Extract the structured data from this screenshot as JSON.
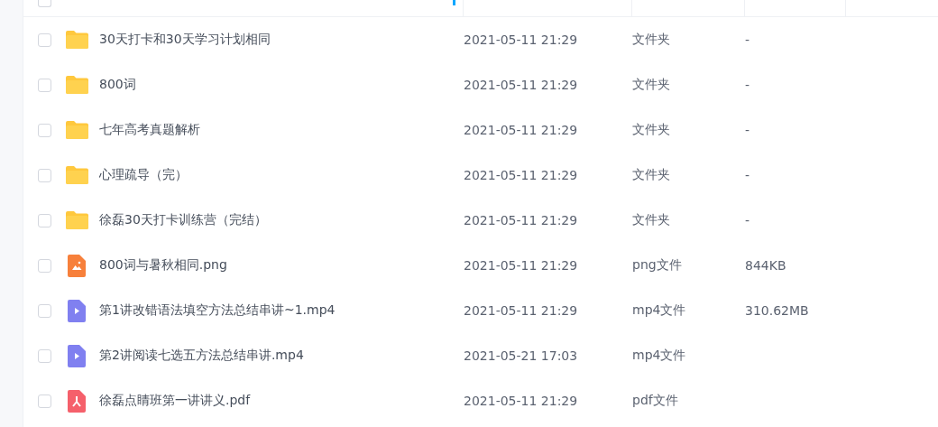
{
  "select_all": {
    "checked": false
  },
  "files": [
    {
      "kind": "folder",
      "name": "30天打卡和30天学习计划相同",
      "modified": "2021-05-11 21:29",
      "type": "文件夹",
      "size": "-",
      "checked": false
    },
    {
      "kind": "folder",
      "name": "800词",
      "modified": "2021-05-11 21:29",
      "type": "文件夹",
      "size": "-",
      "checked": false
    },
    {
      "kind": "folder",
      "name": "七年高考真题解析",
      "modified": "2021-05-11 21:29",
      "type": "文件夹",
      "size": "-",
      "checked": false
    },
    {
      "kind": "folder",
      "name": "心理疏导（完）",
      "modified": "2021-05-11 21:29",
      "type": "文件夹",
      "size": "-",
      "checked": false
    },
    {
      "kind": "folder",
      "name": "徐磊30天打卡训练营（完结）",
      "modified": "2021-05-11 21:29",
      "type": "文件夹",
      "size": "-",
      "checked": false
    },
    {
      "kind": "image",
      "name": "800词与暑秋相同.png",
      "modified": "2021-05-11 21:29",
      "type": "png文件",
      "size": "844KB",
      "checked": false
    },
    {
      "kind": "video",
      "name": "第1讲改错语法填空方法总结串讲~1.mp4",
      "modified": "2021-05-11 21:29",
      "type": "mp4文件",
      "size": "310.62MB",
      "checked": false
    },
    {
      "kind": "video",
      "name": "第2讲阅读七选五方法总结串讲.mp4",
      "modified": "2021-05-21 17:03",
      "type": "mp4文件",
      "checked": false
    },
    {
      "kind": "pdf",
      "name": "徐磊点睛班第一讲讲义.pdf",
      "modified": "2021-05-11 21:29",
      "type": "pdf文件",
      "checked": false
    }
  ]
}
